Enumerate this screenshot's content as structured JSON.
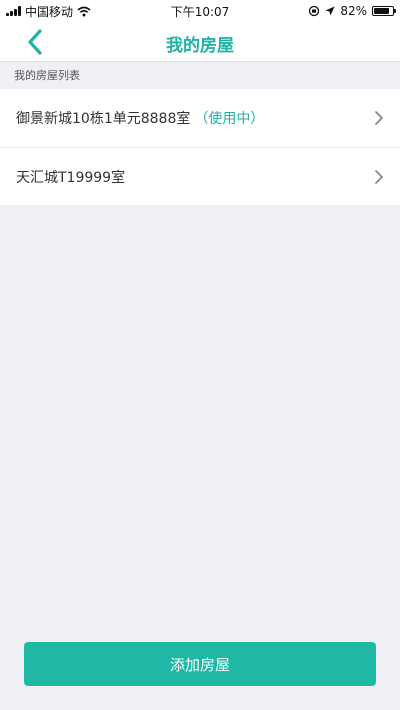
{
  "status_bar": {
    "carrier": "中国移动",
    "time": "下午10:07",
    "battery_text": "82%",
    "battery_level": 0.82
  },
  "nav": {
    "title": "我的房屋",
    "back_icon": "chevron-left-icon"
  },
  "section": {
    "title": "我的房屋列表"
  },
  "houses": [
    {
      "name": "御景新城10栋1单元8888室",
      "status": "（使用中）"
    },
    {
      "name": "天汇城T19999室",
      "status": ""
    }
  ],
  "actions": {
    "add_label": "添加房屋"
  },
  "colors": {
    "accent": "#20b2a3",
    "button": "#1fb8a5",
    "background": "#efeff4"
  }
}
